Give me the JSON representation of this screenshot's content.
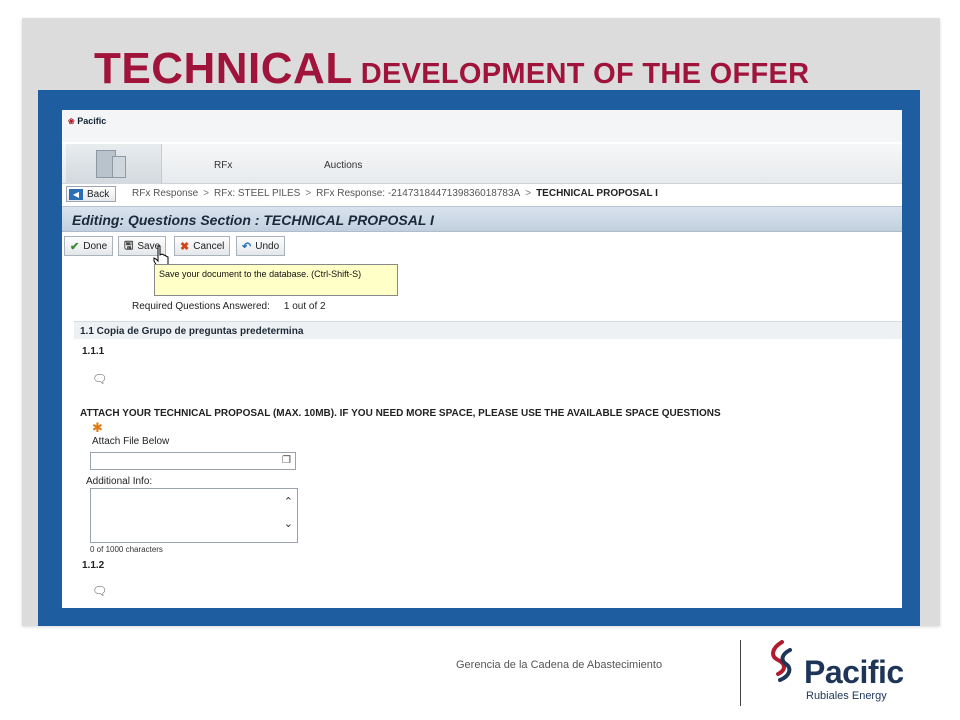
{
  "slide": {
    "title_big": "TECHNICAL",
    "title_small": "DEVELOPMENT OF THE OFFER"
  },
  "app": {
    "logo_text": "Pacific",
    "logo_sub": "Pacific",
    "nav_tabs": [
      "RFx",
      "Auctions"
    ],
    "back_label": "Back",
    "breadcrumbs": [
      "RFx Response",
      "RFx: STEEL PILES",
      "RFx Response: -2147318447139836018783A",
      "TECHNICAL PROPOSAL I"
    ],
    "edit_header": "Editing: Questions Section : TECHNICAL PROPOSAL I",
    "toolbar": {
      "done": "Done",
      "save": "Save",
      "cancel": "Cancel",
      "undo": "Undo"
    },
    "tooltip": "Save your document to the database. (Ctrl-Shift-S)",
    "required_label": "Required Questions Answered:",
    "required_value": "1 out of 2",
    "section_title": "1.1 Copia de Grupo de preguntas predetermina",
    "q1_num": "1.1.1",
    "attach_title": "ATTACH YOUR TECHNICAL PROPOSAL (MAX. 10MB). IF YOU NEED MORE SPACE, PLEASE USE THE AVAILABLE SPACE QUESTIONS",
    "attach_label": "Attach File Below",
    "additional_label": "Additional Info:",
    "char_count": "0 of 1000 characters",
    "q2_num": "1.1.2"
  },
  "footer": {
    "department": "Gerencia de la Cadena de Abastecimiento",
    "brand": "Pacific",
    "brand_sub": "Rubiales Energy"
  },
  "colors": {
    "title": "#a0143c",
    "frame": "#1d5da0",
    "brand_navy": "#1e3558",
    "brand_red": "#b01c2e"
  }
}
